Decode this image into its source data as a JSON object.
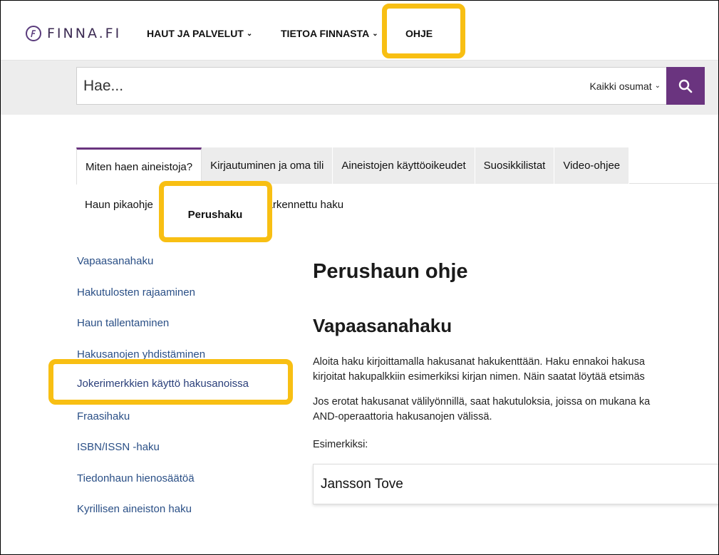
{
  "colors": {
    "accent": "#6a347f",
    "highlight": "#f8bf13",
    "link": "#2a4f86"
  },
  "header": {
    "logo_text": "FINNA.FI",
    "logo_icon": "finna-logo-icon",
    "nav": [
      {
        "label": "HAUT JA PALVELUT",
        "has_dropdown": true
      },
      {
        "label": "TIETOA FINNASTA",
        "has_dropdown": true
      },
      {
        "label": "OHJE",
        "has_dropdown": false
      }
    ]
  },
  "search": {
    "placeholder": "Hae...",
    "scope": "Kaikki osumat",
    "button_icon": "search-icon"
  },
  "tabs": [
    {
      "label": "Miten haen aineistoja?",
      "active": true
    },
    {
      "label": "Kirjautuminen ja oma tili",
      "active": false
    },
    {
      "label": "Aineistojen käyttöoikeudet",
      "active": false
    },
    {
      "label": "Suosikkilistat",
      "active": false
    },
    {
      "label": "Video-ohjee",
      "active": false
    }
  ],
  "subtabs": [
    {
      "label": "Haun pikaohje",
      "active": false
    },
    {
      "label": "Perushaku",
      "active": true
    },
    {
      "label": "Tarkennettu haku",
      "active": false
    }
  ],
  "sidenav": [
    "Vapaasanahaku",
    "Hakutulosten rajaaminen",
    "Haun tallentaminen",
    "Hakusanojen yhdistäminen",
    "Jokerimerkkien käyttö hakusanoissa",
    "Fraasihaku",
    "ISBN/ISSN -haku",
    "Tiedonhaun hienosäätöä",
    "Kyrillisen aineiston haku"
  ],
  "main": {
    "title": "Perushaun ohje",
    "section_title": "Vapaasanahaku",
    "para1_line1": "Aloita haku kirjoittamalla hakusanat hakukenttään. Haku ennakoi hakusa",
    "para1_line2": "kirjoitat hakupalkkiin esimerkiksi kirjan nimen. Näin saatat löytää etsimäs",
    "para2_line1": "Jos erotat hakusanat välilyönnillä, saat hakutuloksia, joissa on mukana ka",
    "para2_line2": "AND-operaattoria hakusanojen välissä.",
    "example_label": "Esimerkiksi:",
    "example_value": "Jansson Tove"
  }
}
